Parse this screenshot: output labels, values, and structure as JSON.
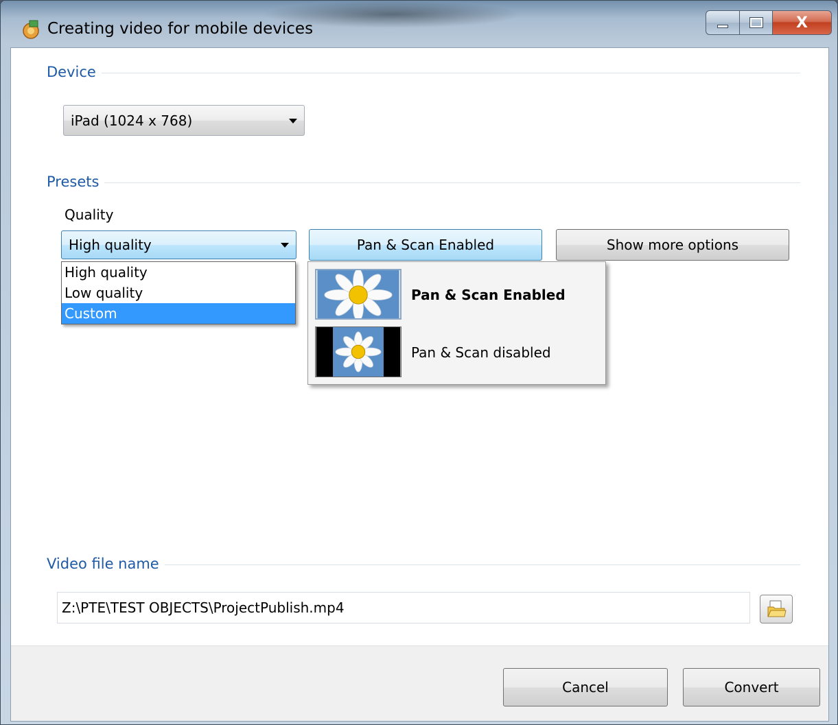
{
  "window": {
    "title": "Creating video for mobile devices",
    "close_glyph": "X"
  },
  "device": {
    "section_label": "Device",
    "selected": "iPad (1024 x 768)"
  },
  "presets": {
    "section_label": "Presets",
    "quality_label": "Quality",
    "quality_selected": "High quality",
    "quality_options": [
      "High quality",
      "Low quality",
      "Custom"
    ],
    "quality_highlighted": "Custom",
    "pan_scan_button": "Pan & Scan Enabled",
    "more_options_button": "Show more options",
    "pan_scan_menu": [
      {
        "label": "Pan & Scan Enabled",
        "selected": true,
        "icon": "daisy-fill-thumbnail"
      },
      {
        "label": "Pan & Scan disabled",
        "selected": false,
        "icon": "daisy-letterbox-thumbnail"
      }
    ]
  },
  "video_file": {
    "section_label": "Video file name",
    "path": "Z:\\PTE\\TEST OBJECTS\\ProjectPublish.mp4"
  },
  "footer": {
    "cancel_label": "Cancel",
    "convert_label": "Convert"
  },
  "colors": {
    "section_label": "#1e5aa6",
    "selection_highlight": "#3399ff",
    "close_button": "#c1401f"
  }
}
